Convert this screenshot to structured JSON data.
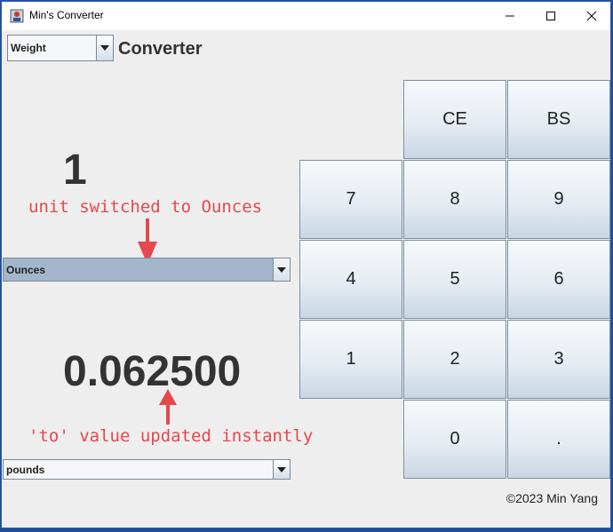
{
  "window": {
    "title": "Min's Converter",
    "controls": {
      "minimize": "minimize-icon",
      "maximize": "maximize-icon",
      "close": "close-icon"
    }
  },
  "header": {
    "category_select": {
      "selected": "Weight"
    },
    "heading": "Converter"
  },
  "converter": {
    "from_value": "1",
    "from_unit": "Ounces",
    "to_value": "0.062500",
    "to_unit": "pounds"
  },
  "annotations": {
    "unit_note": "unit switched to Ounces",
    "value_note": "'to' value updated instantly",
    "color": "#e5484d"
  },
  "keypad": {
    "keys": [
      "CE",
      "BS",
      "7",
      "8",
      "9",
      "4",
      "5",
      "6",
      "1",
      "2",
      "3",
      "0",
      "."
    ]
  },
  "footer": {
    "copyright": "©2023 Min Yang"
  },
  "colors": {
    "from_unit_highlight": "#a3b6cc",
    "window_border": "#1e4f9a"
  }
}
